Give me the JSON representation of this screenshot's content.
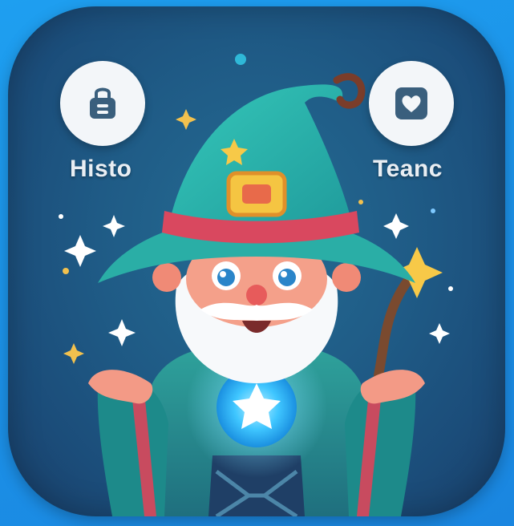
{
  "left_button": {
    "label": "Histo",
    "icon": "shopping-bag-icon",
    "bg_color": "#f3f6f9",
    "icon_color": "#3a5f7d"
  },
  "right_button": {
    "label": "Teanc",
    "icon": "heart-icon",
    "bg_color": "#f3f6f9",
    "icon_color": "#3a5f7d"
  },
  "colors": {
    "background_outer": "#1e9ff0",
    "icon_background": "#1f5b86",
    "hat": "#2bb5b0",
    "hat_band": "#d9485f",
    "buckle": "#f5c542",
    "robe": "#2d8f8c",
    "orb_glow": "#5fd4ff",
    "beard": "#ffffff",
    "skin": "#f4a08a"
  }
}
